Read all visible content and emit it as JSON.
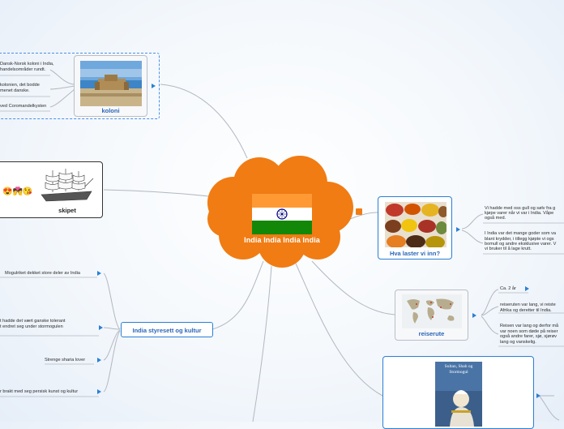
{
  "center": {
    "title": "India India India India"
  },
  "colors": {
    "cloud": "#f07c13",
    "accent": "#2a7fd4",
    "saffron": "#ff9933",
    "green": "#138808",
    "chakra": "#000080"
  },
  "nodes": {
    "koloni": {
      "label": "koloni",
      "notes": [
        "Dansk-Norsk koloni i India,",
        "handelsområder rundt.",
        "kolonien, det bodde",
        "menet danske.",
        "ved Coromandelkysten"
      ]
    },
    "skipet": {
      "label": "skipet",
      "emojis": "😍💏😘"
    },
    "laster": {
      "label": "Hva laster vi inn?",
      "notes": [
        "Vi hadde med oss gull og sølv fra g",
        "kjøpe varer når vi var i India. Våpe",
        "også med.",
        "I India var det mange goder som va",
        "blant krydder, i tillegg kjøpte vi ogs",
        "bomull og andre eksklusive varer. V",
        "vi bruker til å lage krutt."
      ]
    },
    "reiserute": {
      "label": "reiserute",
      "notes": [
        "Ca. 2 år",
        "reiseruten var lang, vi reiste",
        "Afrika og deretter til India.",
        "Reisen var lang og derfor må",
        "var noen som døde på reiser",
        "også andre farer, sjø, sjørøv",
        "lang og vanskelig."
      ]
    },
    "styresett": {
      "label": "India styresett og kultur",
      "notes": [
        "Mogulriket dekket store deler av India",
        "t hadde det vært ganske tolerant",
        "t endret seg under stormogulen",
        "Strenge sharia lover",
        "r brakt med seg persisk kunst og kultur"
      ]
    },
    "book": {
      "title": "Sultan, Shah og Stormogul"
    }
  }
}
